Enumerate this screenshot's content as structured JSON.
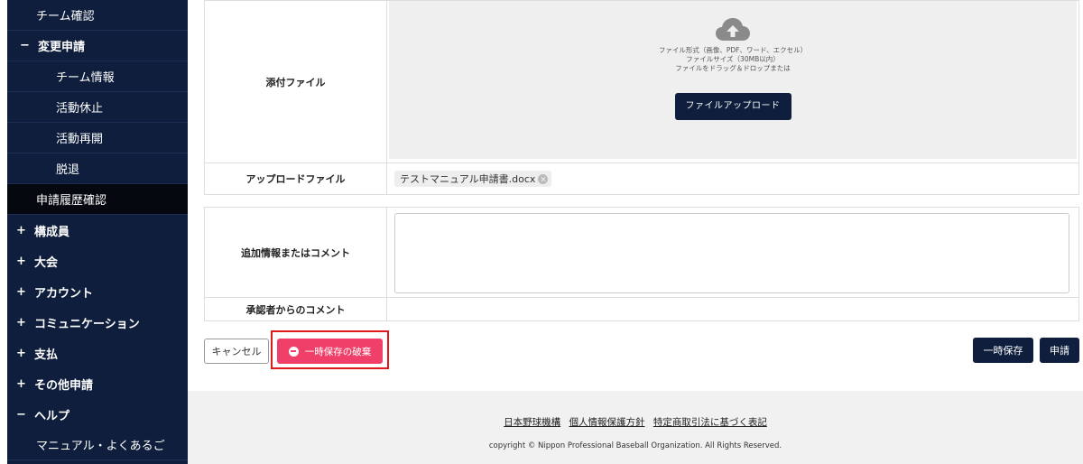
{
  "sidebar": {
    "items": [
      {
        "prefix": "",
        "label": "チーム確認"
      },
      {
        "prefix": "−",
        "label": "変更申請"
      },
      {
        "prefix": "",
        "label": "チーム情報"
      },
      {
        "prefix": "",
        "label": "活動休止"
      },
      {
        "prefix": "",
        "label": "活動再開"
      },
      {
        "prefix": "",
        "label": "脱退"
      },
      {
        "prefix": "",
        "label": "申請履歴確認"
      },
      {
        "prefix": "+",
        "label": "構成員"
      },
      {
        "prefix": "+",
        "label": "大会"
      },
      {
        "prefix": "+",
        "label": "アカウント"
      },
      {
        "prefix": "+",
        "label": "コミュニケーション"
      },
      {
        "prefix": "+",
        "label": "支払"
      },
      {
        "prefix": "+",
        "label": "その他申請"
      },
      {
        "prefix": "−",
        "label": "ヘルプ"
      },
      {
        "prefix": "",
        "label": "マニュアル・よくあるご"
      }
    ]
  },
  "form": {
    "attachment_label": "添付ファイル",
    "dropzone_lines": [
      "ファイル形式（画像、PDF、ワード、エクセル）",
      "ファイルサイズ（30MB以内）",
      "ファイルをドラッグ＆ドロップまたは"
    ],
    "upload_button": "ファイルアップロード",
    "uploaded_label": "アップロードファイル",
    "uploaded_file": "テストマニュアル申請書.docx",
    "comment_label": "追加情報またはコメント",
    "comment_value": "",
    "approver_label": "承認者からのコメント",
    "approver_value": ""
  },
  "actions": {
    "cancel": "キャンセル",
    "discard": "一時保存の破棄",
    "temp_save": "一時保存",
    "submit": "申請"
  },
  "footer": {
    "links": [
      "日本野球機構",
      "個人情報保護方針",
      "特定商取引法に基づく表記"
    ],
    "copyright": "copyright © Nippon Professional Baseball Organization. All Rights Reserved."
  },
  "colors": {
    "sidebar_bg": "#0e1e3c",
    "primary": "#0e1e3c",
    "danger": "#f0406a",
    "highlight": "#e01a1a"
  }
}
